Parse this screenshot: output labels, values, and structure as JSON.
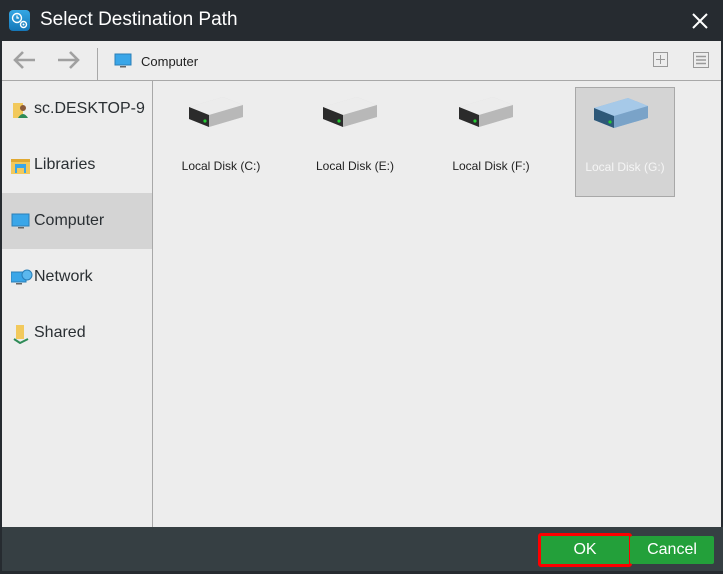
{
  "window": {
    "title": "Select Destination Path",
    "app_icon": "backup-gear-clock-icon",
    "close_icon": "close-icon"
  },
  "toolbar": {
    "back_icon": "arrow-left-icon",
    "forward_icon": "arrow-right-icon",
    "breadcrumb_icon": "computer-monitor-icon",
    "breadcrumb": "Computer",
    "new_folder_icon": "plus-box-icon",
    "view_icon": "list-view-icon"
  },
  "sidebar": {
    "items": [
      {
        "label": "sc.DESKTOP-9",
        "icon": "user-folder-icon",
        "active": false
      },
      {
        "label": "Libraries",
        "icon": "libraries-folder-icon",
        "active": false
      },
      {
        "label": "Computer",
        "icon": "computer-monitor-icon",
        "active": true
      },
      {
        "label": "Network",
        "icon": "network-icon",
        "active": false
      },
      {
        "label": "Shared",
        "icon": "shared-folder-icon",
        "active": false
      }
    ]
  },
  "content": {
    "disks": [
      {
        "label": "Local Disk (C:)",
        "icon": "hard-drive-icon",
        "selected": false
      },
      {
        "label": "Local Disk (E:)",
        "icon": "hard-drive-icon",
        "selected": false
      },
      {
        "label": "Local Disk (F:)",
        "icon": "hard-drive-icon",
        "selected": false
      },
      {
        "label": "Local Disk (G:)",
        "icon": "hard-drive-icon",
        "selected": true
      }
    ]
  },
  "footer": {
    "ok_label": "OK",
    "cancel_label": "Cancel"
  },
  "colors": {
    "titlebar": "#262b30",
    "footer": "#363f43",
    "button_green": "#23a03a",
    "highlight_red": "#ff0000",
    "selection": "#d4d4d4"
  }
}
